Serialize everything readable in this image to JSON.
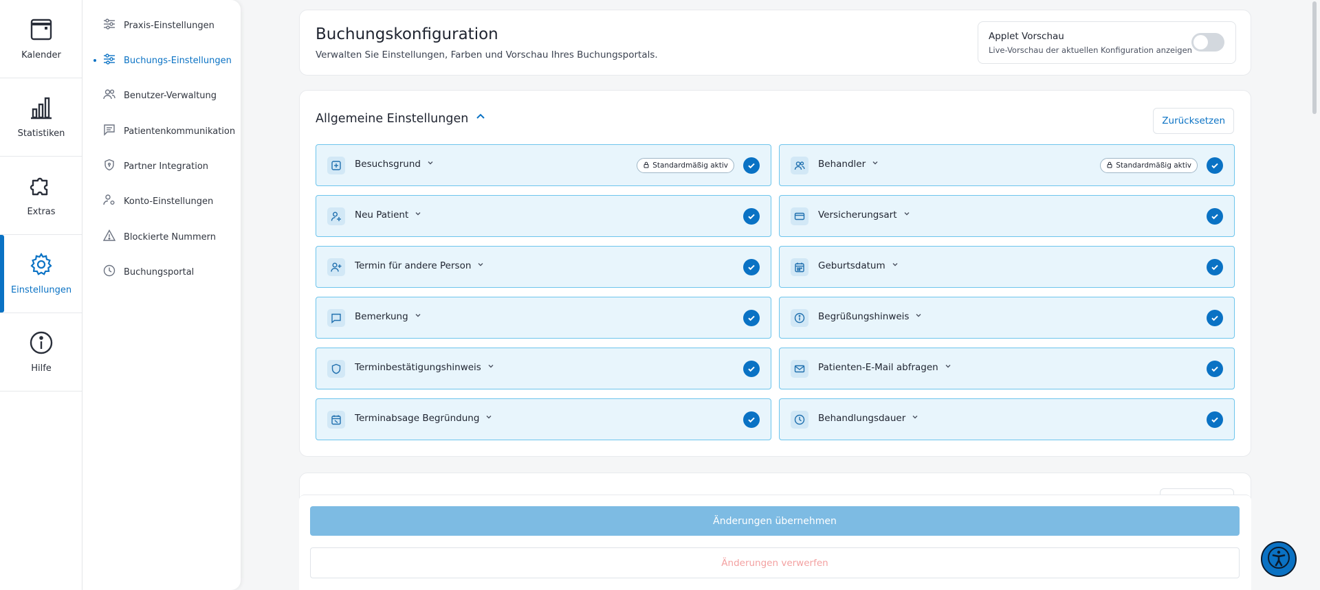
{
  "rail": {
    "items": [
      {
        "label": "Kalender",
        "icon": "calendar-icon"
      },
      {
        "label": "Statistiken",
        "icon": "bar-chart-icon"
      },
      {
        "label": "Extras",
        "icon": "puzzle-icon"
      },
      {
        "label": "Einstellungen",
        "icon": "gear-icon",
        "active": true
      },
      {
        "label": "Hilfe",
        "icon": "info-icon"
      }
    ]
  },
  "subnav": {
    "items": [
      {
        "label": "Praxis-Einstellungen",
        "icon": "sliders-icon"
      },
      {
        "label": "Buchungs-Einstellungen",
        "icon": "sliders-icon",
        "active": true
      },
      {
        "label": "Benutzer-Verwaltung",
        "icon": "users-icon"
      },
      {
        "label": "Patientenkommunikation",
        "icon": "message-icon"
      },
      {
        "label": "Partner Integration",
        "icon": "shield-icon"
      },
      {
        "label": "Konto-Einstellungen",
        "icon": "user-settings-icon"
      },
      {
        "label": "Blockierte Nummern",
        "icon": "warning-icon"
      },
      {
        "label": "Buchungsportal",
        "icon": "clock-icon"
      }
    ]
  },
  "header": {
    "title": "Buchungskonfiguration",
    "subtitle": "Verwalten Sie Einstellungen, Farben und Vorschau Ihres Buchungsportals.",
    "preview": {
      "title": "Applet Vorschau",
      "subtitle": "Live-Vorschau der aktuellen Konfiguration anzeigen",
      "enabled": false
    }
  },
  "general": {
    "title": "Allgemeine Einstellungen",
    "reset_label": "Zurücksetzen",
    "badge_label": "Standardmäßig aktiv",
    "options": [
      {
        "label": "Besuchsgrund",
        "icon": "plus-square-icon",
        "badge": true,
        "checked": true
      },
      {
        "label": "Behandler",
        "icon": "users-icon",
        "badge": true,
        "checked": true
      },
      {
        "label": "Neu Patient",
        "icon": "user-plus-icon",
        "badge": false,
        "checked": true
      },
      {
        "label": "Versicherungsart",
        "icon": "credit-card-icon",
        "badge": false,
        "checked": true
      },
      {
        "label": "Termin für andere Person",
        "icon": "user-add-icon",
        "badge": false,
        "checked": true
      },
      {
        "label": "Geburtsdatum",
        "icon": "calendar-grid-icon",
        "badge": false,
        "checked": true
      },
      {
        "label": "Bemerkung",
        "icon": "message-icon",
        "badge": false,
        "checked": true
      },
      {
        "label": "Begrüßungshinweis",
        "icon": "info-icon",
        "badge": false,
        "checked": true
      },
      {
        "label": "Terminbestätigungshinweis",
        "icon": "shield-icon",
        "badge": false,
        "checked": true
      },
      {
        "label": "Patienten-E-Mail abfragen",
        "icon": "mail-icon",
        "badge": false,
        "checked": true
      },
      {
        "label": "Terminabsage Begründung",
        "icon": "calendar-x-icon",
        "badge": false,
        "checked": true
      },
      {
        "label": "Behandlungsdauer",
        "icon": "clock-icon",
        "badge": false,
        "checked": true
      }
    ]
  },
  "footer": {
    "apply_label": "Änderungen übernehmen",
    "discard_label": "Änderungen verwerfen"
  },
  "colors": {
    "accent": "#0a72c4",
    "option_bg": "#e8f5fc",
    "option_border": "#6cc4ec",
    "apply_bg": "#7dbbe3",
    "discard_text": "#f3a1a1"
  }
}
